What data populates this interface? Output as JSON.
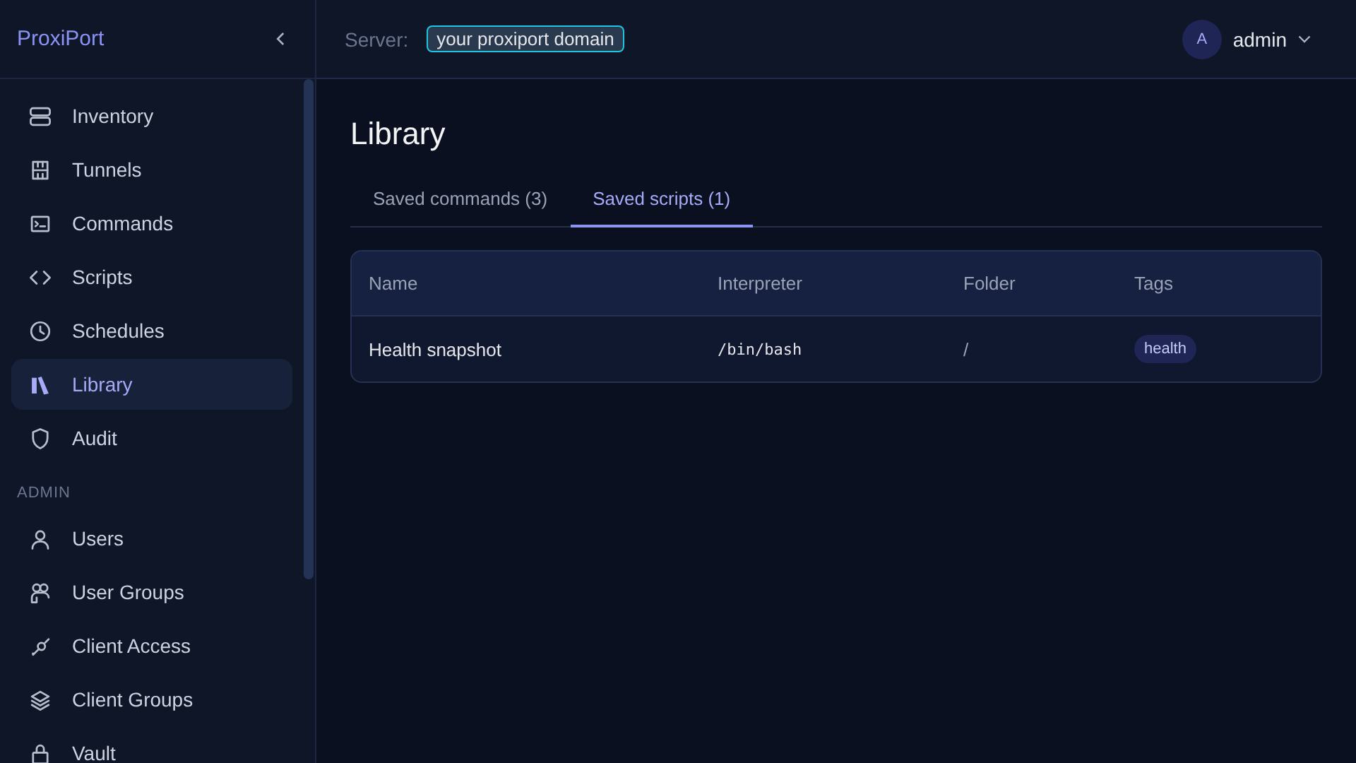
{
  "sidebar": {
    "brand": "ProxiPort",
    "items": [
      {
        "label": "Inventory",
        "selected": false
      },
      {
        "label": "Tunnels",
        "selected": false
      },
      {
        "label": "Commands",
        "selected": false
      },
      {
        "label": "Scripts",
        "selected": false
      },
      {
        "label": "Schedules",
        "selected": false
      },
      {
        "label": "Library",
        "selected": true
      },
      {
        "label": "Audit",
        "selected": false
      }
    ],
    "section": "ADMIN",
    "admin_items": [
      {
        "label": "Users",
        "selected": false
      },
      {
        "label": "User Groups",
        "selected": false
      },
      {
        "label": "Client Access",
        "selected": false
      },
      {
        "label": "Client Groups",
        "selected": false
      },
      {
        "label": "Vault",
        "selected": false
      }
    ]
  },
  "header": {
    "server_label": "Server:",
    "server_value": "your proxiport domain",
    "avatar": "A",
    "user": "admin"
  },
  "page": {
    "title": "Library",
    "tabs": [
      {
        "label": "Saved commands (3)",
        "selected": false
      },
      {
        "label": "Saved scripts (1)",
        "selected": true
      }
    ],
    "table": {
      "columns": [
        "Name",
        "Interpreter",
        "Folder",
        "Tags"
      ],
      "rows": [
        {
          "name": "Health snapshot",
          "interpreter": "/bin/bash",
          "folder": "/",
          "tags": [
            "health"
          ]
        }
      ]
    }
  }
}
